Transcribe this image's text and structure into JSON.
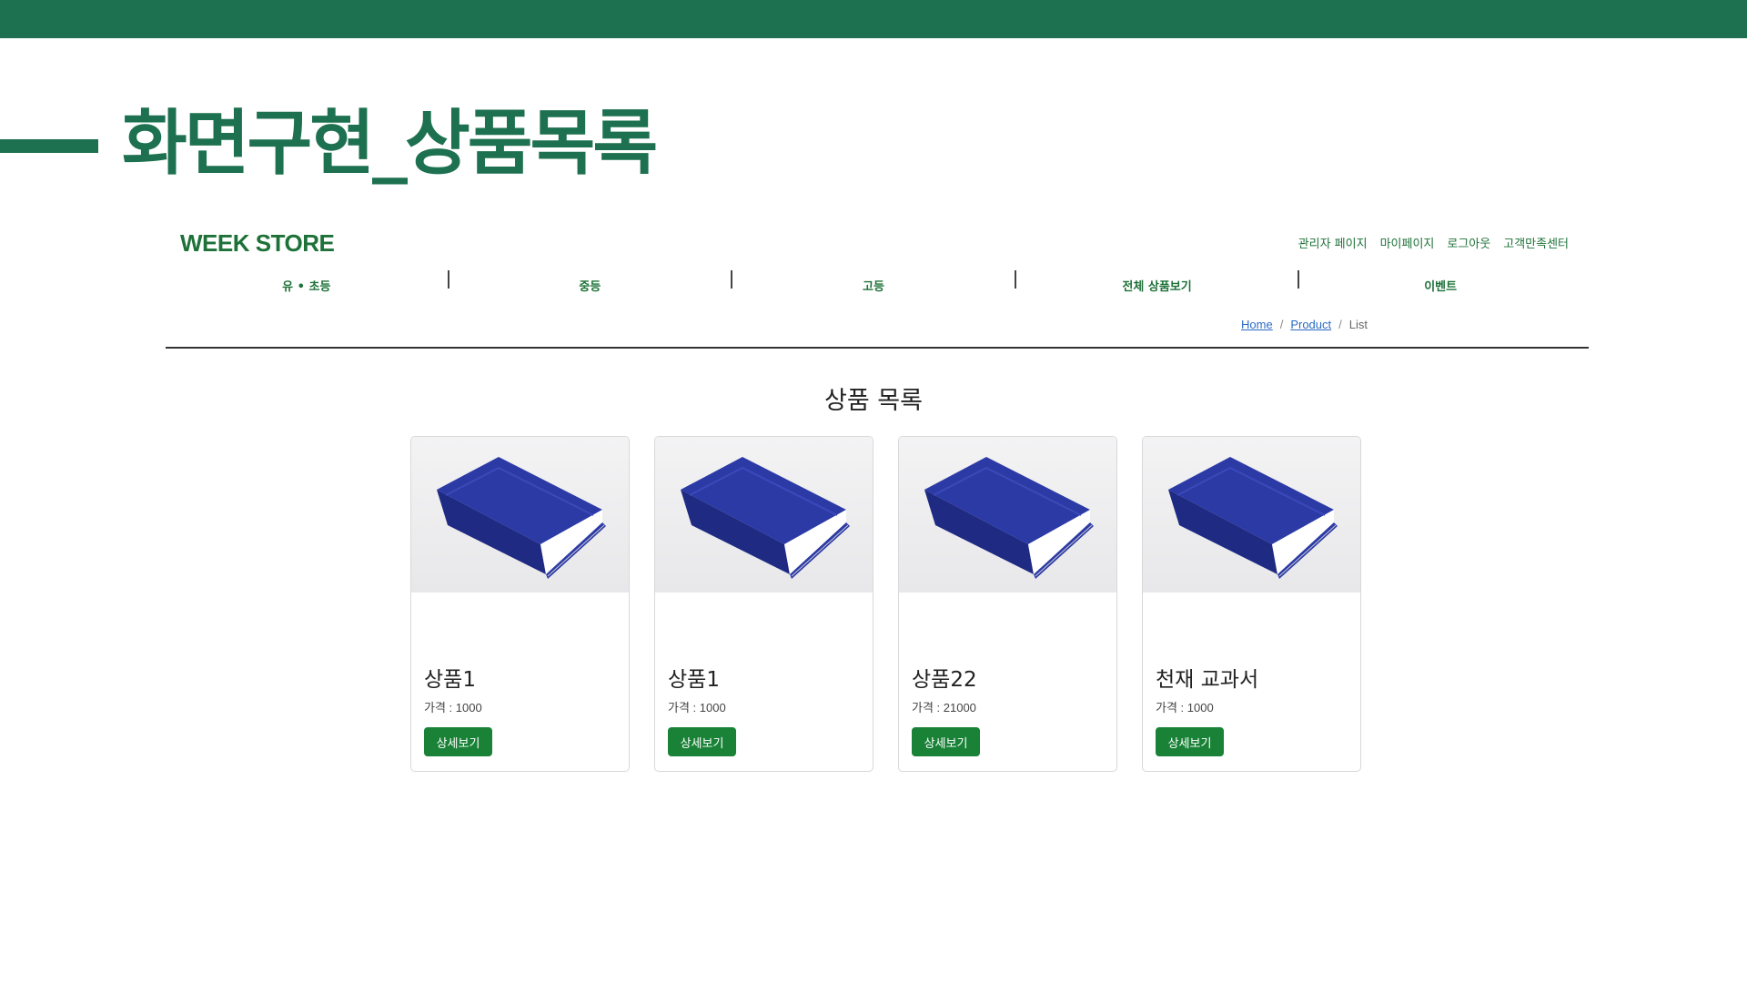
{
  "slide": {
    "title": "화면구현_상품목록"
  },
  "header": {
    "logo": "WEEK STORE",
    "links": [
      {
        "label": "관리자 페이지"
      },
      {
        "label": "마이페이지"
      },
      {
        "label": "로그아웃"
      },
      {
        "label": "고객만족센터"
      }
    ]
  },
  "nav": {
    "items": [
      {
        "label": "유 • 초등"
      },
      {
        "label": "중등"
      },
      {
        "label": "고등"
      },
      {
        "label": "전체 상품보기"
      },
      {
        "label": "이벤트"
      }
    ]
  },
  "breadcrumb": {
    "home": "Home",
    "product": "Product",
    "current": "List",
    "sep": "/"
  },
  "main": {
    "title": "상품 목록",
    "products": [
      {
        "name": "상품1",
        "price": "가격 : 1000",
        "button": "상세보기",
        "image_icon": "book-icon"
      },
      {
        "name": "상품1",
        "price": "가격 : 1000",
        "button": "상세보기",
        "image_icon": "book-icon"
      },
      {
        "name": "상품22",
        "price": "가격 : 21000",
        "button": "상세보기",
        "image_icon": "book-icon"
      },
      {
        "name": "천재 교과서",
        "price": "가격 : 1000",
        "button": "상세보기",
        "image_icon": "book-icon"
      }
    ]
  },
  "colors": {
    "brand": "#1e7150",
    "nav_text": "#1e7138",
    "button": "#198237",
    "book_cover": "#2c3aa6"
  }
}
